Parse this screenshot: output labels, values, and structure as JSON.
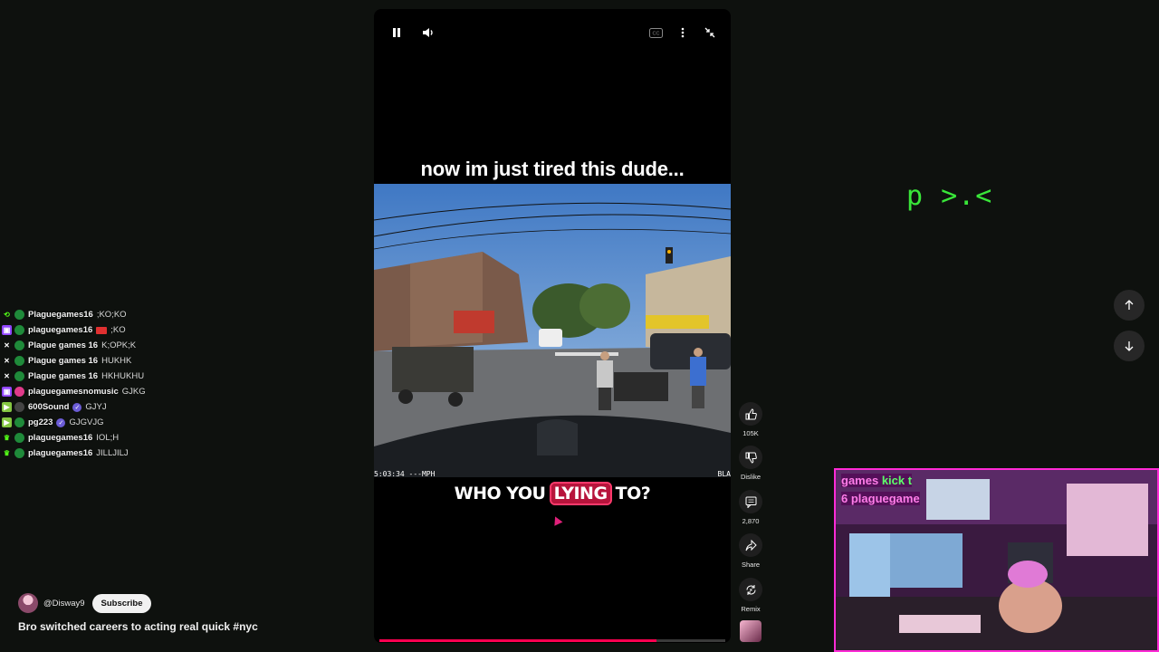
{
  "chat": [
    {
      "platform": "kick",
      "badge_color": "#1f8a3a",
      "user": "Plaguegames16",
      "msg": ";KO;KO"
    },
    {
      "platform": "twitch",
      "badge_color": "#1f8a3a",
      "user": "plaguegames16",
      "msg": ";KO",
      "cam": true
    },
    {
      "platform": "x",
      "badge_color": "#1f8a3a",
      "user": "Plague games 16",
      "msg": "K;OPK;K"
    },
    {
      "platform": "x",
      "badge_color": "#1f8a3a",
      "user": "Plague games 16",
      "msg": "HUKHK"
    },
    {
      "platform": "x",
      "badge_color": "#1f8a3a",
      "user": "Plague games 16",
      "msg": "HKHUKHU"
    },
    {
      "platform": "twitch",
      "badge_color": "#e03a8a",
      "user": "plaguegamesnomusic",
      "msg": "GJKG"
    },
    {
      "platform": "rumble",
      "badge_color": "#444",
      "user": "600Sound",
      "msg": "GJYJ",
      "verified": true
    },
    {
      "platform": "rumble",
      "badge_color": "#1f8a3a",
      "user": "pg223",
      "msg": "GJGVJG",
      "verified": true
    },
    {
      "platform": "kick2",
      "badge_color": "#1f8a3a",
      "user": "plaguegames16",
      "msg": "IOL;H"
    },
    {
      "platform": "kick2",
      "badge_color": "#1f8a3a",
      "user": "plaguegames16",
      "msg": "JILLJILJ"
    }
  ],
  "channel": {
    "handle": "@Disway9",
    "subscribe_label": "Subscribe"
  },
  "video": {
    "title": "Bro switched careers to acting real quick #nyc",
    "caption_top": "now im just tired this dude...",
    "caption_bottom_before": "WHO YOU ",
    "caption_bottom_highlight": "LYING",
    "caption_bottom_after": " TO?",
    "dashcam_left": "5:03:34 ---MPH",
    "dashcam_right": "BLA",
    "progress": 0.8
  },
  "actions": {
    "likes": "105K",
    "dislike_label": "Dislike",
    "comments": "2,870",
    "share_label": "Share",
    "remix_label": "Remix"
  },
  "overlay_text": "p >.<",
  "webcam": {
    "label_line1_a": "games ",
    "label_line1_b": "kick t",
    "label_line2": "6 plaguegame"
  },
  "colors": {
    "accent": "#ff0050",
    "webcam_border": "#ff2bd6",
    "overlay_green": "#39e639"
  }
}
